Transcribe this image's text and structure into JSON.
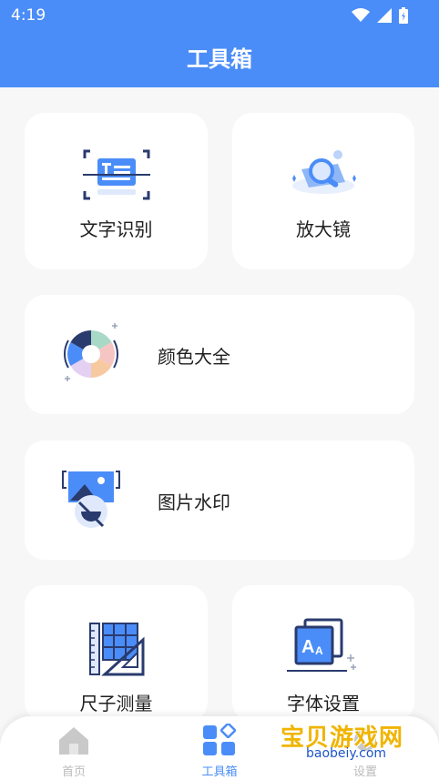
{
  "status": {
    "time": "4:19"
  },
  "header": {
    "title": "工具箱"
  },
  "tools": {
    "ocr": "文字识别",
    "magnifier": "放大镜",
    "colors": "颜色大全",
    "watermark": "图片水印",
    "ruler": "尺子测量",
    "font": "字体设置"
  },
  "tabs": {
    "home": "首页",
    "toolbox": "工具箱",
    "settings": "设置"
  },
  "watermark": {
    "text": "宝贝游戏网",
    "sub": "baobeiy.com"
  },
  "colors": {
    "accent": "#4b8df8",
    "background": "#f7f7f7"
  }
}
